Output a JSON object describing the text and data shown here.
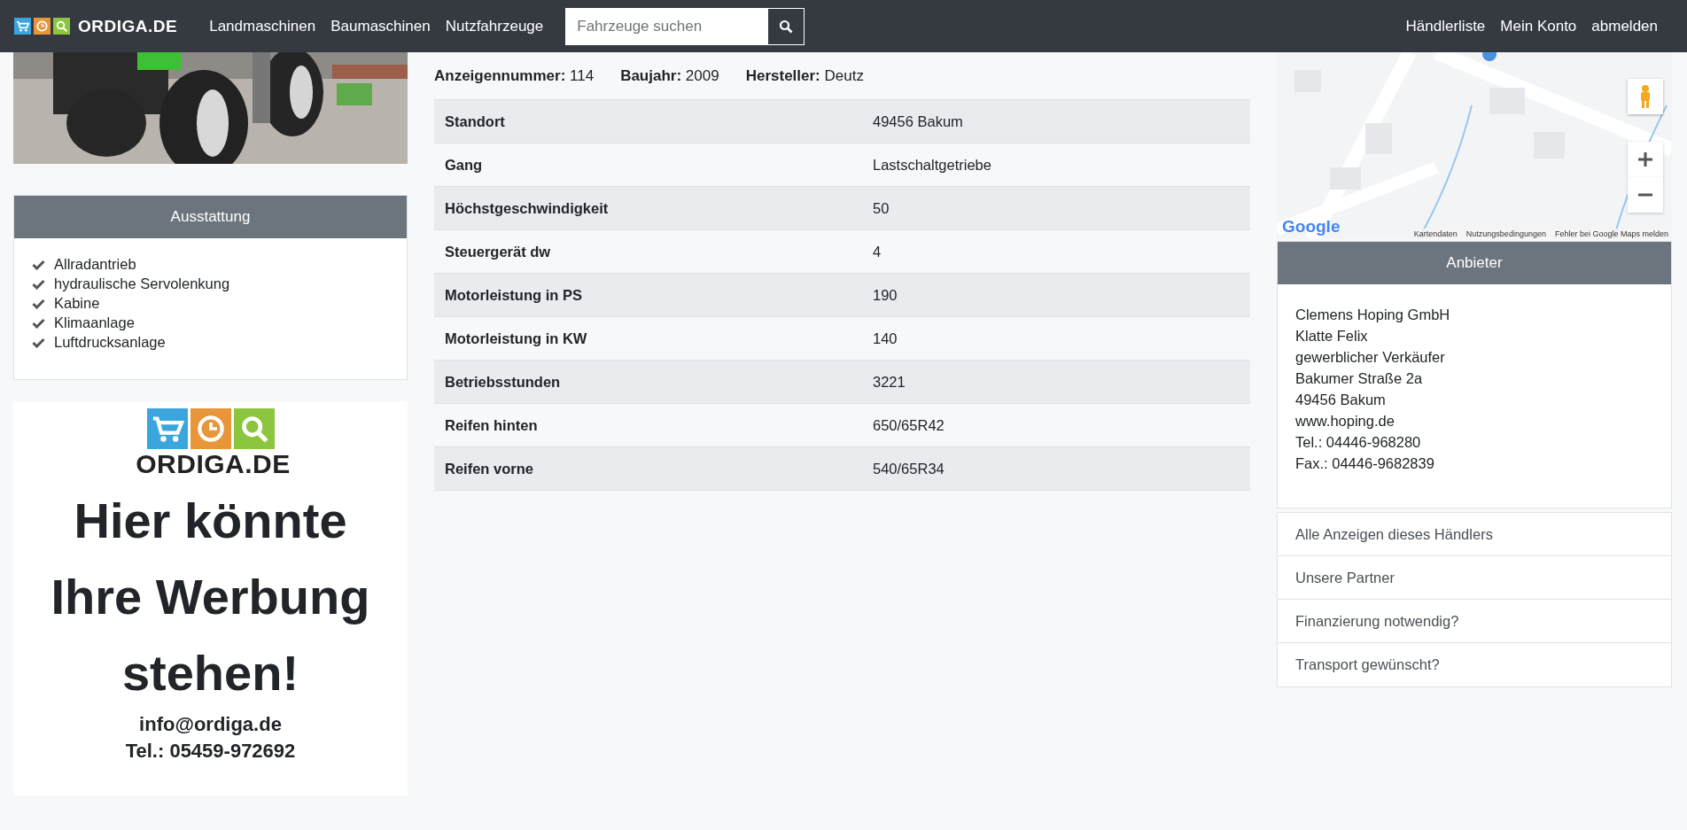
{
  "header": {
    "logo_text": "ORDIGA.DE",
    "nav": [
      "Landmaschinen",
      "Baumaschinen",
      "Nutzfahrzeuge"
    ],
    "search": {
      "placeholder": "Fahrzeuge suchen"
    },
    "user_nav": [
      "Händlerliste",
      "Mein Konto",
      "abmelden"
    ]
  },
  "equipment": {
    "title": "Ausstattung",
    "items": [
      "Allradantrieb",
      "hydraulische Servolenkung",
      "Kabine",
      "Klimaanlage",
      "Luftdrucksanlage"
    ]
  },
  "ad": {
    "logo_text": "ORDIGA.DE",
    "headline": "Hier könnte Ihre Werbung stehen!",
    "email": "info@ordiga.de",
    "phone": "Tel.: 05459-972692"
  },
  "meta": [
    {
      "label": "Anzeigennummer:",
      "value": "114"
    },
    {
      "label": "Baujahr:",
      "value": "2009"
    },
    {
      "label": "Hersteller:",
      "value": "Deutz"
    }
  ],
  "specs": [
    {
      "label": "Standort",
      "value": "49456 Bakum"
    },
    {
      "label": "Gang",
      "value": "Lastschaltgetriebe"
    },
    {
      "label": "Höchstgeschwindigkeit",
      "value": "50"
    },
    {
      "label": "Steuergerät dw",
      "value": "4"
    },
    {
      "label": "Motorleistung in PS",
      "value": "190"
    },
    {
      "label": "Motorleistung in KW",
      "value": "140"
    },
    {
      "label": "Betriebsstunden",
      "value": "3221"
    },
    {
      "label": "Reifen hinten",
      "value": "650/65R42"
    },
    {
      "label": "Reifen vorne",
      "value": "540/65R34"
    }
  ],
  "map": {
    "logo": "Google",
    "footer_links": [
      "Kartendaten",
      "Nutzungsbedingungen",
      "Fehler bei Google Maps melden"
    ]
  },
  "dealer": {
    "title": "Anbieter",
    "lines": [
      "Clemens Hoping GmbH",
      "Klatte Felix",
      "gewerblicher Verkäufer",
      "Bakumer Straße 2a",
      "49456 Bakum",
      "www.hoping.de",
      "Tel.: 04446-968280",
      "Fax.: 04446-9682839"
    ],
    "links": [
      "Alle Anzeigen dieses Händlers",
      "Unsere Partner",
      "Finanzierung notwendig?",
      "Transport gewünscht?"
    ]
  }
}
